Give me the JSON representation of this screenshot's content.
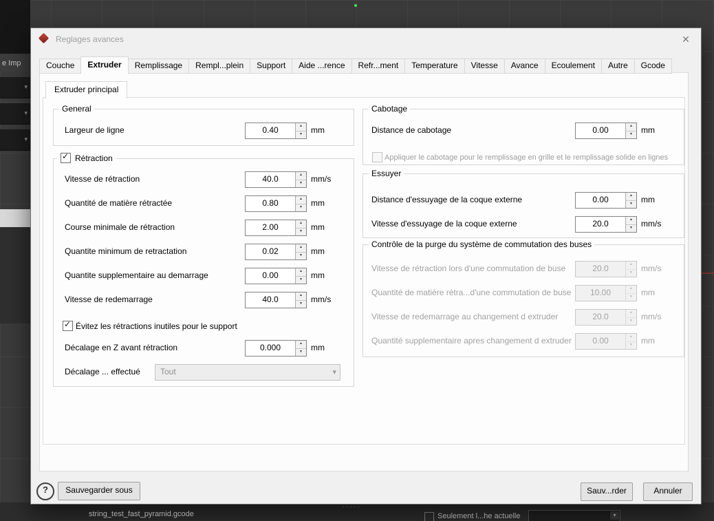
{
  "icons": {
    "spin_up": "▲",
    "spin_down": "▼",
    "chevron_down": "▾",
    "close": "✕",
    "help": "?"
  },
  "window": {
    "title": "Reglages avances"
  },
  "tabs": {
    "items": [
      "Couche",
      "Extruder",
      "Remplissage",
      "Rempl...plein",
      "Support",
      "Aide ...rence",
      "Refr...ment",
      "Temperature",
      "Vitesse",
      "Avance",
      "Ecoulement",
      "Autre",
      "Gcode"
    ],
    "selected": "Extruder"
  },
  "subtab": {
    "label": "Extruder principal"
  },
  "general": {
    "title": "General",
    "rows": [
      {
        "label": "Largeur de ligne",
        "value": "0.40",
        "unit": "mm"
      }
    ]
  },
  "retraction": {
    "title": "Rétraction",
    "checked": true,
    "rows": [
      {
        "label": "Vitesse de rétraction",
        "value": "40.0",
        "unit": "mm/s"
      },
      {
        "label": "Quantité de matière rétractée",
        "value": "0.80",
        "unit": "mm"
      },
      {
        "label": "Course minimale de rétraction",
        "value": "2.00",
        "unit": "mm"
      },
      {
        "label": "Quantite minimum de retractation",
        "value": "0.02",
        "unit": "mm"
      },
      {
        "label": "Quantite supplementaire au demarrage",
        "value": "0.00",
        "unit": "mm"
      },
      {
        "label": "Vitesse de redemarrage",
        "value": "40.0",
        "unit": "mm/s"
      }
    ],
    "avoid_label": "Évitez les rétractions inutiles pour le support",
    "zhop": {
      "label": "Décalage en Z avant rétraction",
      "value": "0.000",
      "unit": "mm"
    },
    "combo": {
      "label": "Décalage ... effectué",
      "value": "Tout"
    }
  },
  "cabotage": {
    "title": "Cabotage",
    "rows": [
      {
        "label": "Distance de cabotage",
        "value": "0.00",
        "unit": "mm"
      }
    ],
    "checkbox_label": "Appliquer le cabotage pour le remplissage en grille et le remplissage solide en lignes"
  },
  "essuyer": {
    "title": "Essuyer",
    "rows": [
      {
        "label": "Distance d'essuyage de la coque externe",
        "value": "0.00",
        "unit": "mm"
      },
      {
        "label": "Vitesse d'essuyage de la coque externe",
        "value": "20.0",
        "unit": "mm/s"
      }
    ]
  },
  "purge": {
    "title": "Contrôle de la purge du système de commutation des buses",
    "rows": [
      {
        "label": "Vitesse de rétraction lors d'une commutation de buse",
        "value": "20.0",
        "unit": "mm/s"
      },
      {
        "label": "Quantité de matière rétra...d'une commutation de buse",
        "value": "10.00",
        "unit": "mm"
      },
      {
        "label": "Vitesse de redemarrage au changement d extruder",
        "value": "20.0",
        "unit": "mm/s"
      },
      {
        "label": "Quantité supplementaire apres changement d extruder",
        "value": "0.00",
        "unit": "mm"
      }
    ]
  },
  "footer": {
    "save_as": "Sauvegarder sous",
    "save": "Sauv...rder",
    "cancel": "Annuler"
  },
  "background": {
    "left_tab": "e  Imp",
    "gcode_file": "string_test_fast_pyramid.gcode",
    "dots": "·····",
    "layer_label": "Seulement l...he actuelle"
  },
  "colors": {
    "dialog_bg": "#f0f0f0",
    "viewport_bg": "#3b3b3b",
    "icon_red": "#9e2b25"
  }
}
